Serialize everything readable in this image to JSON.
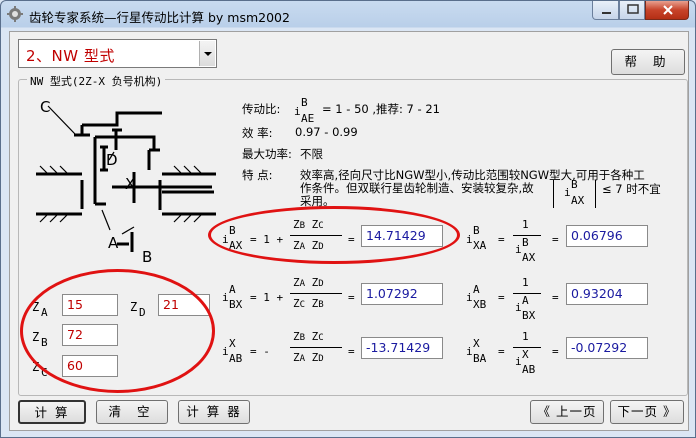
{
  "window": {
    "title": "齿轮专家系统—行星传动比计算 by msm2002"
  },
  "combo": {
    "selected": "2、NW   型式"
  },
  "buttons": {
    "help": "帮 助",
    "calc": "计 算",
    "clear": "清 空",
    "calculator": "计 算 器",
    "prev": "《 上一页",
    "next": "下一页 》"
  },
  "group": {
    "caption": "NW 型式(2Z-X 负号机构)"
  },
  "info": {
    "ratio_label": "传动比:",
    "ratio_value": "= 1 - 50 ,推荐: 7 - 21",
    "eff_label": "效  率:",
    "eff_value": "0.97 - 0.99",
    "power_label": "最大功率:",
    "power_value": "不限",
    "feature_label": "特  点:",
    "feature_text1": "效率高,径向尺寸比NGW型小,传动比范围较NGW型大,可用于各种工",
    "feature_text2": "作条件。但双联行星齿轮制造、安装较复杂,故",
    "feature_text3": "采用。",
    "feature_cond": "≤ 7 时不宜"
  },
  "diagram": {
    "label_C": "C",
    "label_D": "D",
    "label_X": "X",
    "label_A": "A",
    "label_B": "B"
  },
  "inputs": {
    "za_label": "A",
    "zb_label": "B",
    "zc_label": "C",
    "zd_label": "D",
    "za": "15",
    "zb": "72",
    "zc": "60",
    "zd": "21"
  },
  "results": {
    "iB_AX": "14.71429",
    "iB_XA": "0.06796",
    "iA_BX": "1.07292",
    "iA_XB": "0.93204",
    "iX_AB": "-13.71429",
    "iX_BA": "-0.07292"
  },
  "colors": {
    "annotation": "#e01212",
    "input_text": "#c00000",
    "result_text": "#1a1aa0"
  }
}
